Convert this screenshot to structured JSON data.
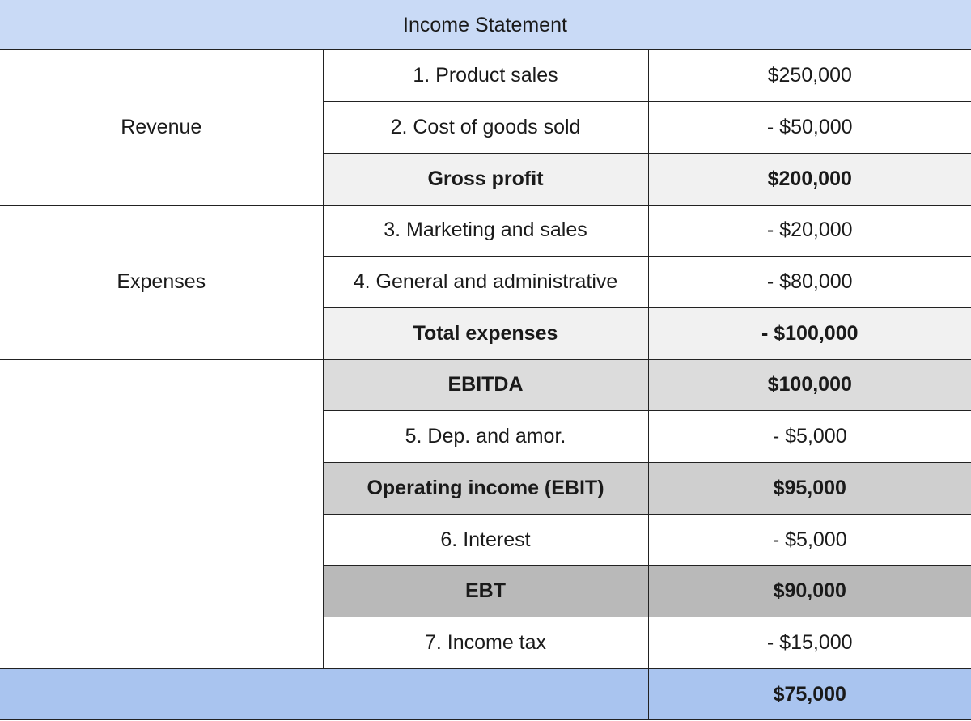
{
  "title": "Income Statement",
  "groups": {
    "revenue": "Revenue",
    "expenses": "Expenses"
  },
  "rows": [
    {
      "item": "1. Product sales",
      "value": "$250,000"
    },
    {
      "item": "2. Cost of goods sold",
      "value": "- $50,000"
    },
    {
      "item": "Gross profit",
      "value": "$200,000"
    },
    {
      "item": "3. Marketing and sales",
      "value": "- $20,000"
    },
    {
      "item": "4. General and administrative",
      "value": "- $80,000"
    },
    {
      "item": "Total expenses",
      "value": "- $100,000"
    },
    {
      "item": "EBITDA",
      "value": "$100,000"
    },
    {
      "item": "5. Dep. and amor.",
      "value": "- $5,000"
    },
    {
      "item": "Operating income (EBIT)",
      "value": "$95,000"
    },
    {
      "item": "6. Interest",
      "value": "- $5,000"
    },
    {
      "item": "EBT",
      "value": "$90,000"
    },
    {
      "item": "7. Income tax",
      "value": "- $15,000"
    }
  ],
  "net_income": {
    "value": "$75,000"
  },
  "colors": {
    "header_blue": "#c9daf6",
    "total_blue": "#a9c4ef",
    "shade_light": "#f1f1f1",
    "shade_mid": "#dcdcdc",
    "shade_dark": "#b9b9b9"
  }
}
